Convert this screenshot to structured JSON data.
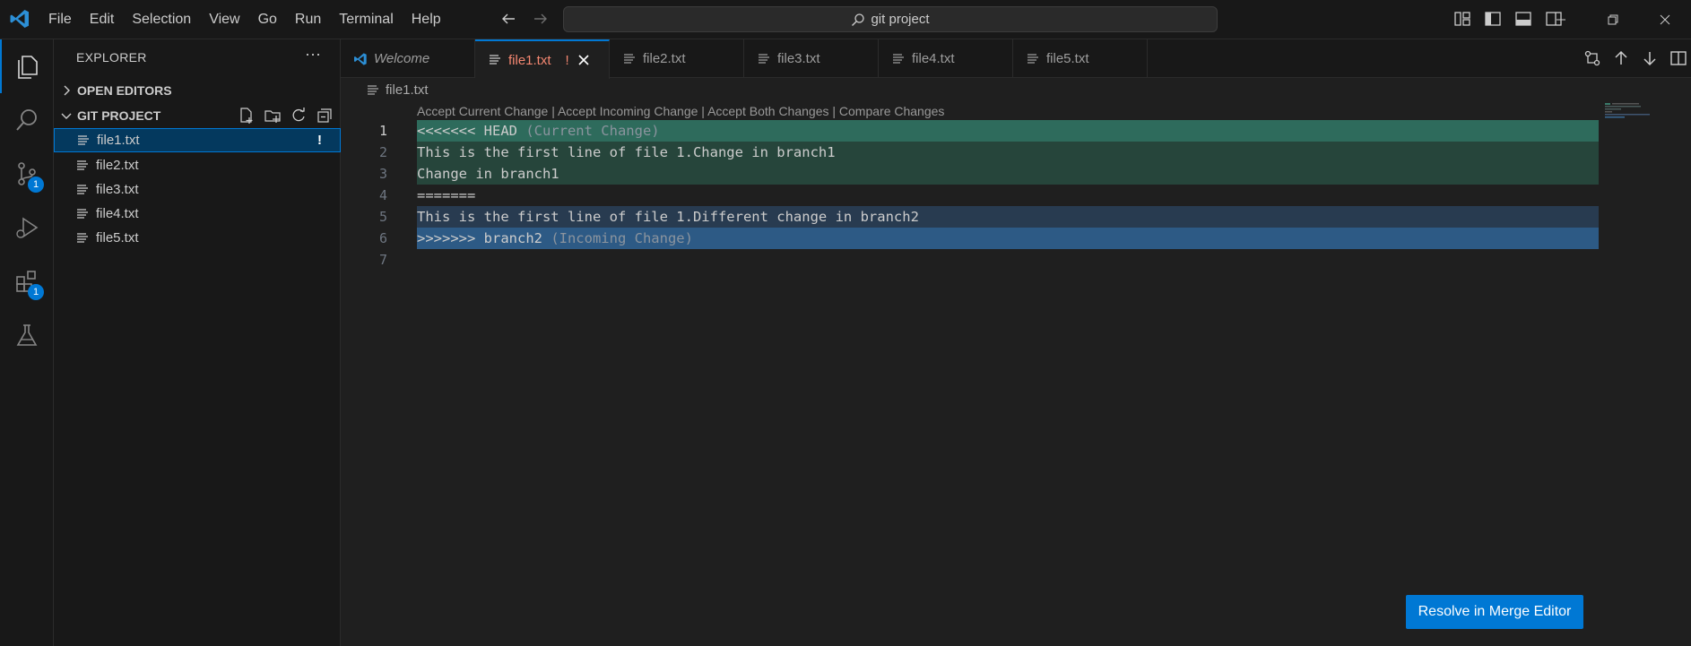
{
  "menu": [
    "File",
    "Edit",
    "Selection",
    "View",
    "Go",
    "Run",
    "Terminal",
    "Help"
  ],
  "command_center": {
    "label": "git project"
  },
  "activity": {
    "source_control_badge": "1",
    "extensions_badge": "1"
  },
  "sidebar": {
    "title": "EXPLORER",
    "more": "···",
    "open_editors": "OPEN EDITORS",
    "project": "GIT PROJECT",
    "files": [
      {
        "name": "file1.txt",
        "status": "!"
      },
      {
        "name": "file2.txt"
      },
      {
        "name": "file3.txt"
      },
      {
        "name": "file4.txt"
      },
      {
        "name": "file5.txt"
      }
    ]
  },
  "tabs": [
    {
      "label": "Welcome"
    },
    {
      "label": "file1.txt",
      "status": "!"
    },
    {
      "label": "file2.txt"
    },
    {
      "label": "file3.txt"
    },
    {
      "label": "file4.txt"
    },
    {
      "label": "file5.txt"
    }
  ],
  "breadcrumb": "file1.txt",
  "codelens": {
    "accept_current": "Accept Current Change",
    "accept_incoming": "Accept Incoming Change",
    "accept_both": "Accept Both Changes",
    "compare": "Compare Changes",
    "separator": " | "
  },
  "lines": [
    {
      "n": "1",
      "text": "<<<<<<< HEAD",
      "hint": " (Current Change)"
    },
    {
      "n": "2",
      "text": "This is the first line of file 1.Change in branch1"
    },
    {
      "n": "3",
      "text": "Change in branch1"
    },
    {
      "n": "4",
      "text": "======="
    },
    {
      "n": "5",
      "text": "This is the first line of file 1.Different change in branch2"
    },
    {
      "n": "6",
      "text": ">>>>>>> branch2",
      "hint": " (Incoming Change)"
    },
    {
      "n": "7",
      "text": ""
    }
  ],
  "resolve_button": "Resolve in Merge Editor",
  "colors": {
    "accent": "#0078d4",
    "current_header": "#2e6b5c",
    "current_body": "#26453b",
    "incoming_body": "#283b50",
    "incoming_header": "#2d5a85",
    "modified_text": "#f48771"
  }
}
